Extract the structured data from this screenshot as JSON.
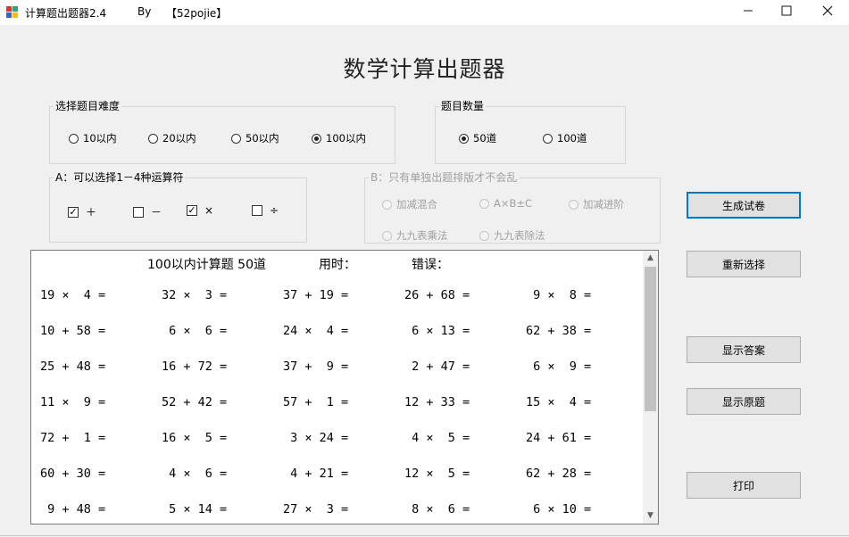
{
  "window": {
    "title": "计算题出题器2.4",
    "by": "By",
    "tag": "【52pojie】",
    "minimize": "—",
    "maximize": "☐",
    "close": "✕"
  },
  "header": {
    "title": "数学计算出题器"
  },
  "difficulty": {
    "legend": "选择题目难度",
    "options": [
      "10以内",
      "20以内",
      "50以内",
      "100以内"
    ],
    "selected": "100以内"
  },
  "count": {
    "legend": "题目数量",
    "options": [
      "50道",
      "100道"
    ],
    "selected": "50道"
  },
  "operators": {
    "legend": "A：可以选择1－4种运算符",
    "items": [
      {
        "label": "＋",
        "checked": true
      },
      {
        "label": "－",
        "checked": false
      },
      {
        "label": "×",
        "checked": true
      },
      {
        "label": "÷",
        "checked": false
      }
    ]
  },
  "modeB": {
    "legend": "B：只有单独出题排版才不会乱",
    "options": [
      "加减混合",
      "A×B±C",
      "加减进阶",
      "九九表乘法",
      "九九表除法"
    ]
  },
  "buttons": {
    "generate": "生成试卷",
    "reselect": "重新选择",
    "show_answers": "显示答案",
    "show_original": "显示原题",
    "print": "打印"
  },
  "sheet": {
    "title": "100以内计算题 50道",
    "time_label": "用时：",
    "errors_label": "错误：",
    "rows": [
      [
        "19 ×  4 =",
        "32 ×  3 =",
        "37 + 19 =",
        "26 + 68 =",
        " 9 ×  8 ="
      ],
      [
        "10 + 58 =",
        " 6 ×  6 =",
        "24 ×  4 =",
        " 6 × 13 =",
        "62 + 38 ="
      ],
      [
        "25 + 48 =",
        "16 + 72 =",
        "37 +  9 =",
        " 2 + 47 =",
        " 6 ×  9 ="
      ],
      [
        "11 ×  9 =",
        "52 + 42 =",
        "57 +  1 =",
        "12 + 33 =",
        "15 ×  4 ="
      ],
      [
        "72 +  1 =",
        "16 ×  5 =",
        " 3 × 24 =",
        " 4 ×  5 =",
        "24 + 61 ="
      ],
      [
        "60 + 30 =",
        " 4 ×  6 =",
        " 4 + 21 =",
        "12 ×  5 =",
        "62 + 28 ="
      ],
      [
        " 9 + 48 =",
        " 5 × 14 =",
        "27 ×  3 =",
        " 8 ×  6 =",
        " 6 × 10 ="
      ]
    ]
  }
}
